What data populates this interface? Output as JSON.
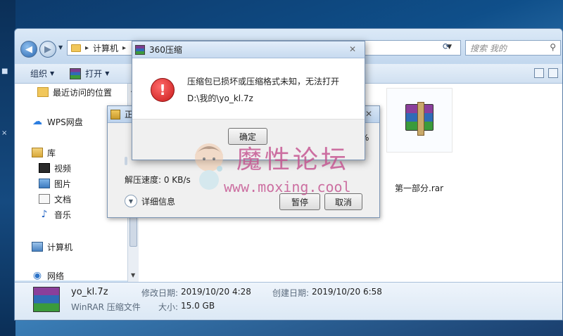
{
  "explorer": {
    "path_label": "计算机",
    "search_placeholder": "搜索 我的",
    "toolbar": {
      "organize": "组织",
      "open": "打开"
    },
    "nav_items": [
      "最近访问的位置",
      "WPS网盘",
      "库",
      "视频",
      "图片",
      "文档",
      "音乐",
      "计算机",
      "网络"
    ],
    "files": [
      {
        "name": "第一部分.rar"
      }
    ],
    "details": {
      "name": "yo_kl.7z",
      "type": "WinRAR 压缩文件",
      "modified_label": "修改日期:",
      "modified_value": "2019/10/20 4:28",
      "created_label": "创建日期:",
      "created_value": "2019/10/20 6:58",
      "size_label": "大小:",
      "size_value": "15.0 GB"
    }
  },
  "progress_dialog": {
    "title_fragment": "正",
    "percent_fragment": "%",
    "speed_text": "解压速度: 0 KB/s",
    "details_label": "详细信息",
    "pause_button": "暂停",
    "cancel_button": "取消"
  },
  "error_dialog": {
    "title": "360压缩",
    "message": "压缩包已损坏或压缩格式未知，无法打开",
    "path": "D:\\我的\\yo_kl.7z",
    "ok_button": "确定"
  },
  "watermark": {
    "title": "魔性论坛",
    "url": "www.moxing.cool"
  },
  "colors": {
    "desktop": "#0f4f8a",
    "error_red": "#c81919",
    "watermark": "#c4508e"
  }
}
